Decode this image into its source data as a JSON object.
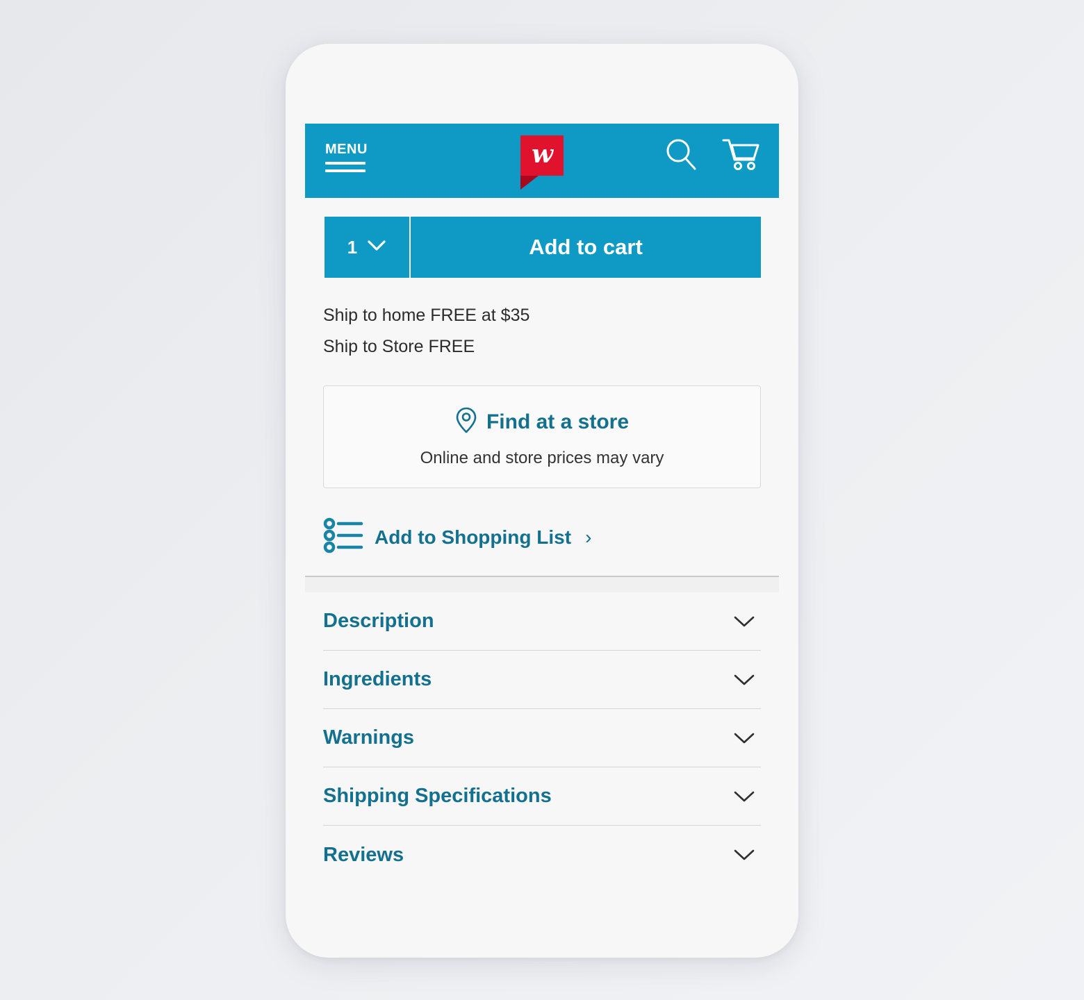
{
  "header": {
    "menu_label": "MENU",
    "logo_letter": "w",
    "icons": {
      "menu": "hamburger-icon",
      "logo": "walgreens-logo",
      "search": "search-icon",
      "cart": "shopping-cart-icon"
    }
  },
  "purchase": {
    "quantity_value": "1",
    "quantity_chevron": "chevron-down-icon",
    "add_to_cart_label": "Add to cart"
  },
  "shipping": {
    "lines": [
      "Ship to home FREE at $35",
      "Ship to Store FREE"
    ]
  },
  "find_store": {
    "icon": "map-pin-icon",
    "title": "Find at a store",
    "subtitle": "Online and store prices may vary"
  },
  "shopping_list": {
    "icon": "list-bullet-icon",
    "label": "Add to Shopping List",
    "chevron": "›"
  },
  "accordion": {
    "items": [
      {
        "label": "Description",
        "chevron": "chevron-down-icon"
      },
      {
        "label": "Ingredients",
        "chevron": "chevron-down-icon"
      },
      {
        "label": "Warnings",
        "chevron": "chevron-down-icon"
      },
      {
        "label": "Shipping Specifications",
        "chevron": "chevron-down-icon"
      },
      {
        "label": "Reviews",
        "chevron": "chevron-down-icon"
      }
    ]
  },
  "colors": {
    "brand_teal": "#0e9ac4",
    "link_teal": "#13708e",
    "logo_red": "#e0122e",
    "logo_red_dark": "#a8091f",
    "page_background": "#e8eaee",
    "screen_background": "#f7f7f7"
  }
}
